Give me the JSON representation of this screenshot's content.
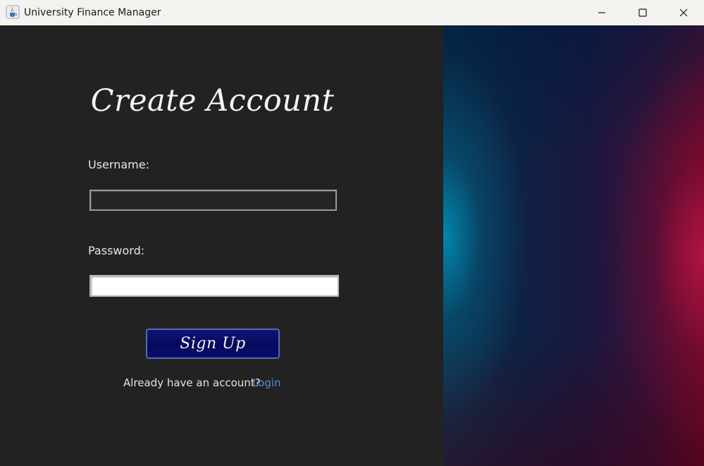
{
  "window": {
    "title": "University Finance Manager",
    "icon": "java-cup-icon",
    "controls": [
      "minimize",
      "maximize",
      "close"
    ]
  },
  "form": {
    "heading": "Create Account",
    "username_label": "Username:",
    "username_value": "",
    "password_label": "Password:",
    "password_value": "",
    "submit_label": "Sign Up",
    "prompt_text": "Already have an account?",
    "login_link": "Login"
  },
  "colors": {
    "background": "#222222",
    "button": "#0a0e6a",
    "link": "#4d8fd6",
    "panel_left_accent": "#0096be",
    "panel_right_accent": "#be1446"
  }
}
